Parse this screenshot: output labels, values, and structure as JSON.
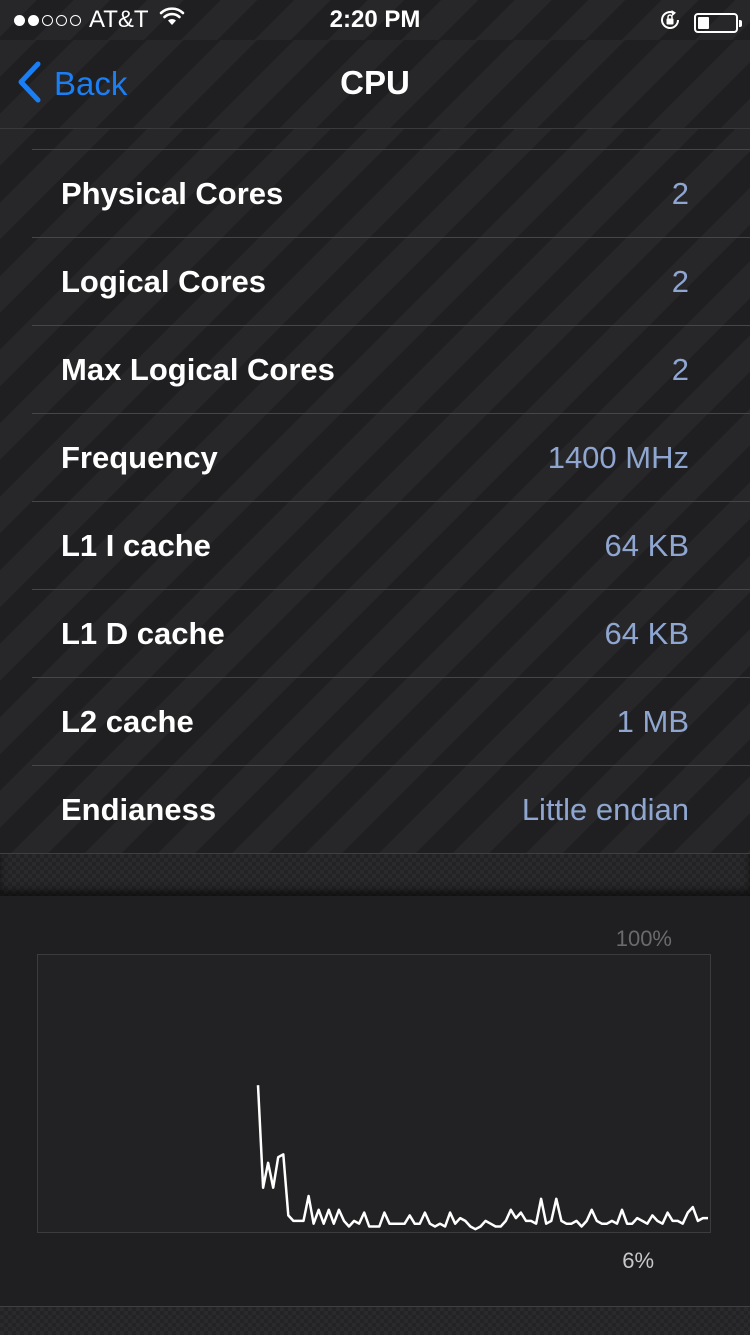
{
  "status_bar": {
    "signal_dots": [
      true,
      true,
      false,
      false,
      false
    ],
    "carrier": "AT&T",
    "time": "2:20 PM",
    "battery_level": 0.3
  },
  "nav": {
    "back_label": "Back",
    "title": "CPU",
    "accent_color": "#1a7ff5"
  },
  "rows": [
    {
      "label": "Physical Cores",
      "value": "2"
    },
    {
      "label": "Logical Cores",
      "value": "2"
    },
    {
      "label": "Max Logical Cores",
      "value": "2"
    },
    {
      "label": "Frequency",
      "value": "1400 MHz"
    },
    {
      "label": "L1 I cache",
      "value": "64 KB"
    },
    {
      "label": "L1 D cache",
      "value": "64 KB"
    },
    {
      "label": "L2 cache",
      "value": "1 MB"
    },
    {
      "label": "Endianess",
      "value": "Little endian"
    }
  ],
  "cpu_graph": {
    "max_label": "100%",
    "current_label": "6%",
    "line_color": "#ffffff",
    "ylim": [
      0,
      100
    ],
    "values": [
      53,
      16,
      25,
      16,
      27,
      28,
      6,
      4,
      4,
      4,
      13,
      3,
      8,
      3,
      8,
      3,
      8,
      4,
      2,
      4,
      3,
      7,
      2,
      2,
      2,
      7,
      3,
      3,
      3,
      3,
      6,
      3,
      3,
      7,
      3,
      2,
      3,
      2,
      7,
      3,
      5,
      4,
      2,
      1,
      2,
      4,
      3,
      2,
      2,
      4,
      8,
      5,
      7,
      4,
      4,
      3,
      12,
      3,
      4,
      12,
      4,
      3,
      3,
      4,
      2,
      4,
      8,
      4,
      3,
      3,
      4,
      3,
      8,
      3,
      3,
      5,
      4,
      3,
      6,
      4,
      3,
      7,
      4,
      4,
      3,
      7,
      9,
      4,
      5,
      5
    ]
  }
}
